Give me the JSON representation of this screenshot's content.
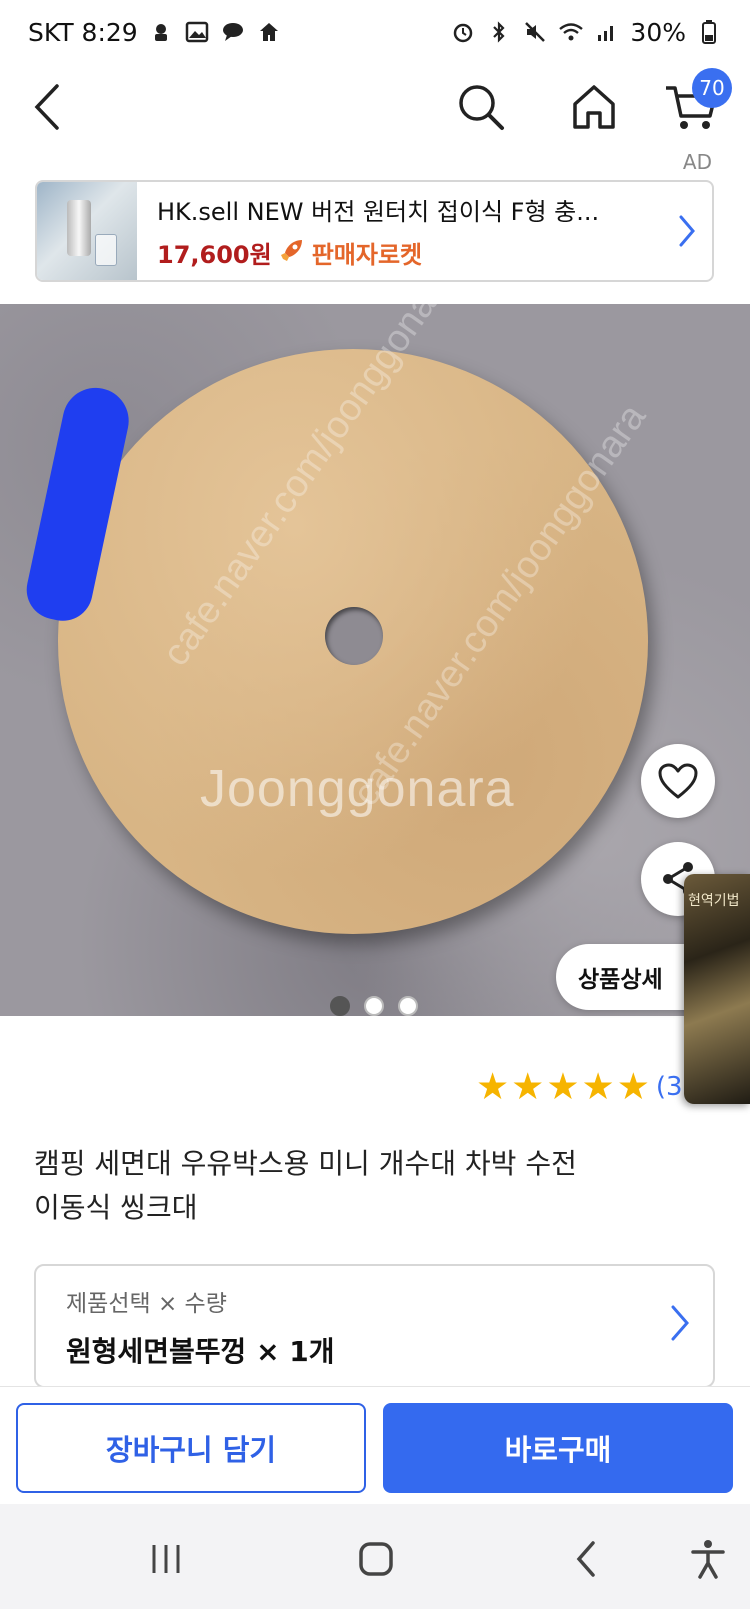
{
  "status_bar": {
    "carrier_time": "SKT 8:29",
    "battery": "30%"
  },
  "nav": {
    "cart_count": "70",
    "ad_label": "AD"
  },
  "ad": {
    "title": "HK.sell NEW 버전 원터치 접이식 F형 충...",
    "price": "17,600원",
    "rocket_label": "판매자로켓"
  },
  "hero": {
    "watermark": "Joonggonara",
    "watermark_diag_1": "cafe.naver.com/joonggonara",
    "watermark_diag_2": "cafe.naver.com/joonggonara",
    "detail_button": "상품상세",
    "side_thumb_text": "현역기법",
    "page_dots": 3,
    "active_dot": 0
  },
  "rating": {
    "stars": 5,
    "count": "(3"
  },
  "product": {
    "title_line1": "캠핑 세면대 우유박스용 미니 개수대 차박 수전",
    "title_line2": "이동식 씽크대"
  },
  "option": {
    "label": "제품선택 × 수량",
    "value": "원형세면볼뚜껑 × 1개"
  },
  "actions": {
    "cart": "장바구니 담기",
    "buy": "바로구매"
  },
  "colors": {
    "accent": "#346aef",
    "price": "#b11d1d",
    "rocket": "#e4662a",
    "star": "#f6b400"
  }
}
